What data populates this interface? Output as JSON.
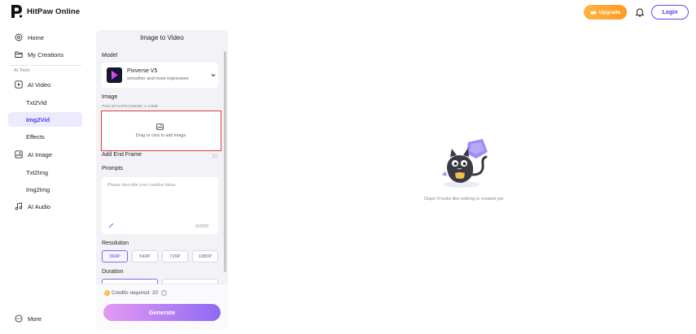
{
  "app": {
    "brand": "HitPaw Online",
    "upgrade_label": "Upgrade",
    "login_label": "Login"
  },
  "sidebar": {
    "items": [
      {
        "label": "Home",
        "icon": "home-icon"
      },
      {
        "label": "My Creations",
        "icon": "folder-icon"
      }
    ],
    "section_label": "AI Tools",
    "tools": [
      {
        "label": "AI Video",
        "icon": "video-icon"
      },
      {
        "label": "Txt2Vid"
      },
      {
        "label": "Img2Vid",
        "active": true
      },
      {
        "label": "Effects"
      },
      {
        "label": "AI Image",
        "icon": "image-icon"
      },
      {
        "label": "Txt2Img"
      },
      {
        "label": "Img2Img"
      },
      {
        "label": "AI Audio",
        "icon": "music-icon"
      }
    ],
    "more_label": "More"
  },
  "panel": {
    "title": "Image to Video",
    "model_label": "Model",
    "model_name": "Pixverse V5",
    "model_desc": "smoother and more expressive",
    "image_label": "Image",
    "formats": "PNG/JPG/JPEG/WEBP, ≤ 10MB",
    "upload_hint": "Drag or click to add image",
    "end_frame_label": "Add End Frame",
    "prompts_label": "Prompts",
    "prompt_placeholder": "Please describe your creative ideas",
    "prompt_counter": "0/2000",
    "resolution_label": "Resolution",
    "resolutions": [
      "360P",
      "540P",
      "720P",
      "1080P"
    ],
    "selected_resolution": "360P",
    "duration_label": "Duration",
    "credits_text": "Credits required: 20",
    "generate_label": "Generate"
  },
  "main": {
    "empty_text": "Oops! It looks like nothing is created yet."
  },
  "colors": {
    "accent": "#5140e8",
    "upgrade": "#ff9a1f",
    "upload_border": "#e53935"
  }
}
